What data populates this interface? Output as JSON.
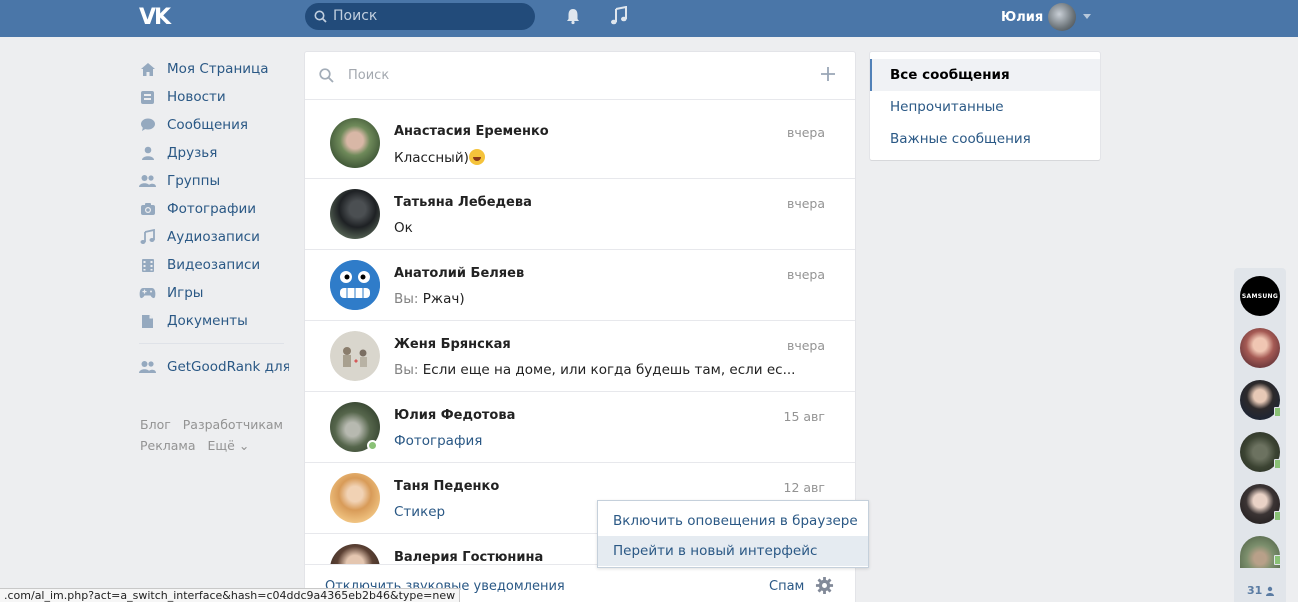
{
  "header": {
    "logo": "VK",
    "search_placeholder": "Поиск",
    "user_name": "Юлия",
    "icons": [
      "bell-icon",
      "music-note-icon"
    ]
  },
  "leftnav": {
    "items": [
      {
        "label": "Моя Страница",
        "icon": "home-icon"
      },
      {
        "label": "Новости",
        "icon": "news-icon"
      },
      {
        "label": "Сообщения",
        "icon": "messages-icon"
      },
      {
        "label": "Друзья",
        "icon": "user-icon"
      },
      {
        "label": "Группы",
        "icon": "users-icon"
      },
      {
        "label": "Фотографии",
        "icon": "camera-icon"
      },
      {
        "label": "Аудиозаписи",
        "icon": "music-icon"
      },
      {
        "label": "Видеозаписи",
        "icon": "film-icon"
      },
      {
        "label": "Игры",
        "icon": "gamepad-icon"
      },
      {
        "label": "Документы",
        "icon": "document-icon"
      }
    ],
    "app_item": {
      "label": "GetGoodRank для...",
      "icon": "users-icon"
    },
    "footer": [
      "Блог",
      "Разработчикам",
      "Реклама",
      "Ещё ⌄"
    ]
  },
  "dialogs": {
    "search_placeholder": "Поиск",
    "items": [
      {
        "name": "Анастасия Еременко",
        "date": "вчера",
        "message": "Классный)",
        "emoji": true,
        "you": "",
        "online": false
      },
      {
        "name": "Татьяна Лебедева",
        "date": "вчера",
        "message": "Ок",
        "you": "",
        "online": false
      },
      {
        "name": "Анатолий Беляев",
        "date": "вчера",
        "message": "Ржач)",
        "you": "Вы: ",
        "online": false
      },
      {
        "name": "Женя Брянская",
        "date": "вчера",
        "message": "Если еще на доме, или когда будешь там, если ес...",
        "you": "Вы: ",
        "online": false
      },
      {
        "name": "Юлия Федотова",
        "date": "15 авг",
        "message": "Фотография",
        "you": "",
        "online": true,
        "link": true
      },
      {
        "name": "Таня Педенко",
        "date": "12 авг",
        "message": "Стикер",
        "you": "",
        "online": false,
        "link": true
      },
      {
        "name": "Валерия Гостюнина",
        "date": "",
        "message": "",
        "you": "",
        "online": false
      }
    ],
    "footer": {
      "sound_label": "Отключить звуковые уведомления",
      "spam_label": "Спам"
    }
  },
  "menu": {
    "items": [
      "Включить оповещения в браузере",
      "Перейти в новый интерфейс"
    ]
  },
  "filter": {
    "items": [
      "Все сообщения",
      "Непрочитанные",
      "Важные сообщения"
    ]
  },
  "chatbar": {
    "first_label": "SAMSUNG",
    "count": "31"
  },
  "statusbar": {
    "url": ".com/al_im.php?act=a_switch_interface&hash=c04ddc9a4365eb2b46&type=new"
  }
}
